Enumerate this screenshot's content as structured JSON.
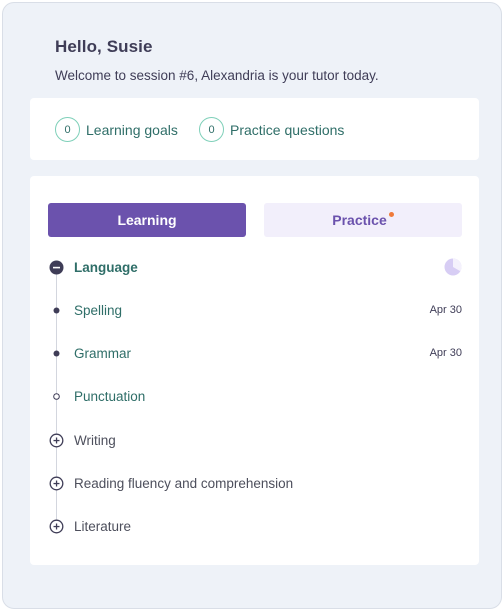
{
  "header": {
    "greeting": "Hello, Susie",
    "welcome": "Welcome to session #6, Alexandria is your tutor today."
  },
  "stats": {
    "learning_goals_count": "0",
    "learning_goals_label": "Learning goals",
    "practice_questions_count": "0",
    "practice_questions_label": "Practice questions"
  },
  "tabs": {
    "learning_label": "Learning",
    "practice_label": "Practice",
    "active": "Learning",
    "practice_has_notification": true
  },
  "tree": {
    "parent": {
      "label": "Language",
      "state": "expanded",
      "icon": "partial-progress-pie-icon"
    },
    "children": [
      {
        "label": "Spelling",
        "date": "Apr 30",
        "status": "done"
      },
      {
        "label": "Grammar",
        "date": "Apr 30",
        "status": "done"
      },
      {
        "label": "Punctuation",
        "date": "",
        "status": "pending"
      }
    ],
    "collapsed": [
      {
        "label": "Writing",
        "icon": "plus-circle-icon"
      },
      {
        "label": "Reading fluency and comprehension",
        "icon": "plus-circle-icon"
      },
      {
        "label": "Literature",
        "icon": "plus-circle-icon"
      }
    ]
  },
  "colors": {
    "accent_purple": "#6b52ad",
    "teal_text": "#2f6e68",
    "notification_orange": "#f07a3a"
  }
}
